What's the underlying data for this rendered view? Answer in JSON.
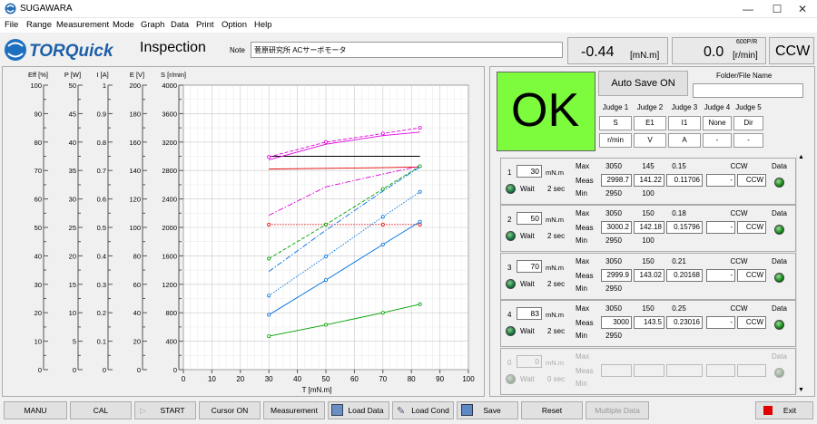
{
  "app": {
    "title": "SUGAWARA"
  },
  "window_controls": {
    "minimize": "—",
    "maximize": "☐",
    "close": "✕"
  },
  "menu": [
    "File",
    "Range",
    "Measurement",
    "Mode",
    "Graph",
    "Data",
    "Print",
    "Option",
    "Help"
  ],
  "header": {
    "logo_text": "TORQuick",
    "page": "Inspection",
    "note_label": "Note",
    "note_value": "菅原研究所 ACサーボモータ",
    "torque_value": "-0.44",
    "torque_unit": "[mN.m]",
    "speed_value": "0.0",
    "speed_scale": "600P/R",
    "speed_unit": "[r/min]",
    "direction": "CCW"
  },
  "axes": {
    "eff": {
      "label": "Eff [%]",
      "ticks": [
        "100",
        "90",
        "80",
        "70",
        "60",
        "50",
        "40",
        "30",
        "20",
        "10",
        "0"
      ]
    },
    "p": {
      "label": "P [W]",
      "ticks": [
        "50",
        "45",
        "40",
        "35",
        "30",
        "25",
        "20",
        "15",
        "10",
        "5",
        "0"
      ]
    },
    "i": {
      "label": "I [A]",
      "ticks": [
        "1",
        "0.9",
        "0.8",
        "0.7",
        "0.6",
        "0.5",
        "0.4",
        "0.3",
        "0.2",
        "0.1",
        "0"
      ]
    },
    "e": {
      "label": "E [V]",
      "ticks": [
        "200",
        "180",
        "160",
        "140",
        "120",
        "100",
        "80",
        "60",
        "40",
        "20",
        "0"
      ]
    },
    "s": {
      "label": "S [r/min]",
      "ticks": [
        "4000",
        "3600",
        "3200",
        "2800",
        "2400",
        "2000",
        "1600",
        "1200",
        "800",
        "400",
        "0"
      ]
    },
    "x": {
      "label": "T [mN.m]",
      "ticks": [
        "0",
        "10",
        "20",
        "30",
        "40",
        "50",
        "60",
        "70",
        "80",
        "90",
        "100"
      ]
    }
  },
  "chart_data": {
    "type": "line",
    "xlabel": "T [mN.m]",
    "ylabel": "S [r/min]",
    "xlim": [
      0,
      100
    ],
    "ylim": [
      0,
      4000
    ],
    "grid": true,
    "series": [
      {
        "color": "#000000",
        "style": "solid",
        "marker": false,
        "x": [
          30,
          50,
          70,
          83
        ],
        "y": [
          3000,
          3000,
          3000,
          3000
        ]
      },
      {
        "color": "#e00000",
        "style": "solid",
        "marker": false,
        "x": [
          30,
          50,
          70,
          83
        ],
        "y": [
          2820,
          2830,
          2840,
          2850
        ]
      },
      {
        "color": "#e00000",
        "style": "dotted",
        "marker": true,
        "x": [
          30,
          50,
          70,
          83
        ],
        "y": [
          2040,
          2040,
          2040,
          2040
        ]
      },
      {
        "color": "#e000e0",
        "style": "solid",
        "marker": false,
        "x": [
          30,
          50,
          70,
          83
        ],
        "y": [
          2950,
          3170,
          3290,
          3340
        ]
      },
      {
        "color": "#e000e0",
        "style": "dashed",
        "marker": true,
        "x": [
          30,
          50,
          70,
          83
        ],
        "y": [
          2990,
          3200,
          3320,
          3400
        ]
      },
      {
        "color": "#e000e0",
        "style": "dashdot",
        "marker": false,
        "x": [
          30,
          50,
          70,
          83
        ],
        "y": [
          2170,
          2570,
          2750,
          2860
        ]
      },
      {
        "color": "#00a000",
        "style": "solid",
        "marker": true,
        "x": [
          30,
          50,
          70,
          83
        ],
        "y": [
          470,
          630,
          800,
          920
        ]
      },
      {
        "color": "#00a000",
        "style": "dashed",
        "marker": true,
        "x": [
          30,
          50,
          70,
          83
        ],
        "y": [
          1560,
          2040,
          2540,
          2860
        ]
      },
      {
        "color": "#0070e0",
        "style": "solid",
        "marker": true,
        "x": [
          30,
          50,
          70,
          83
        ],
        "y": [
          770,
          1260,
          1760,
          2080
        ]
      },
      {
        "color": "#0070e0",
        "style": "dotted",
        "marker": true,
        "x": [
          30,
          50,
          70,
          83
        ],
        "y": [
          1040,
          1590,
          2150,
          2500
        ]
      },
      {
        "color": "#0070e0",
        "style": "dashdot",
        "marker": false,
        "x": [
          30,
          50,
          70,
          83
        ],
        "y": [
          1380,
          1960,
          2510,
          2850
        ]
      }
    ]
  },
  "result": {
    "text": "OK",
    "color": "#7cfc3c"
  },
  "auto_save": {
    "label": "Auto Save ON",
    "folder_label": "Folder/File Name",
    "folder_value": ""
  },
  "judges": [
    {
      "label": "Judge 1",
      "item": "S",
      "unit": "r/min"
    },
    {
      "label": "Judge 2",
      "item": "E1",
      "unit": "V"
    },
    {
      "label": "Judge 3",
      "item": "I1",
      "unit": "A"
    },
    {
      "label": "Judge 4",
      "item": "None",
      "unit": "-"
    },
    {
      "label": "Judge 5",
      "item": "Dir",
      "unit": "-"
    }
  ],
  "row_labels": {
    "max": "Max",
    "meas": "Meas",
    "min": "Min",
    "wait": "Wait",
    "data": "Data",
    "unit": "mN.m"
  },
  "steps": [
    {
      "num": "1",
      "torque": "30",
      "wait": "2 sec",
      "max": [
        "3050",
        "145",
        "0.15",
        "",
        "CCW"
      ],
      "meas": [
        "2998.7",
        "141.22",
        "0.11706",
        "-",
        "CCW"
      ],
      "min": [
        "2950",
        "100",
        "",
        "",
        ""
      ]
    },
    {
      "num": "2",
      "torque": "50",
      "wait": "2 sec",
      "max": [
        "3050",
        "150",
        "0.18",
        "",
        "CCW"
      ],
      "meas": [
        "3000.2",
        "142.18",
        "0.15796",
        "-",
        "CCW"
      ],
      "min": [
        "2950",
        "100",
        "",
        "",
        ""
      ]
    },
    {
      "num": "3",
      "torque": "70",
      "wait": "2 sec",
      "max": [
        "3050",
        "150",
        "0.21",
        "",
        "CCW"
      ],
      "meas": [
        "2999.9",
        "143.02",
        "0.20168",
        "-",
        "CCW"
      ],
      "min": [
        "2950",
        "",
        "",
        "",
        ""
      ]
    },
    {
      "num": "4",
      "torque": "83",
      "wait": "2 sec",
      "max": [
        "3050",
        "150",
        "0.25",
        "",
        "CCW"
      ],
      "meas": [
        "3000",
        "143.5",
        "0.23016",
        "-",
        "CCW"
      ],
      "min": [
        "2950",
        "",
        "",
        "",
        ""
      ]
    },
    {
      "num": "0",
      "torque": "0",
      "wait": "0 sec",
      "max": [
        "",
        "",
        "",
        "",
        ""
      ],
      "meas": [
        "",
        "",
        "",
        "",
        ""
      ],
      "min": [
        "",
        "",
        "",
        "",
        ""
      ]
    }
  ],
  "buttons": {
    "manu": "MANU",
    "cal": "CAL",
    "start": "START",
    "cursor": "Cursor ON",
    "measurement": "Measurement",
    "load_data": "Load Data",
    "load_cond": "Load Cond",
    "save": "Save",
    "reset": "Reset",
    "multiple": "Multiple Data",
    "exit": "Exit"
  }
}
